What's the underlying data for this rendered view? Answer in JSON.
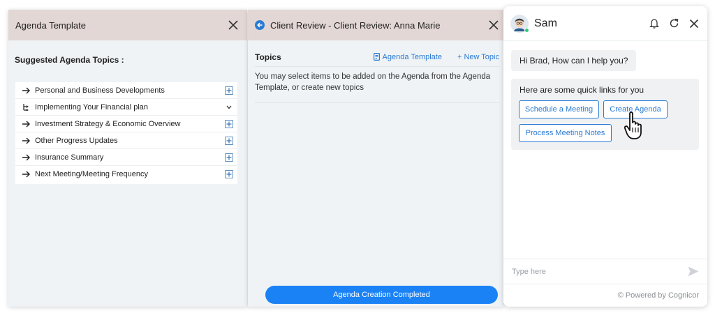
{
  "agenda_panel": {
    "title": "Agenda Template",
    "suggested_label": "Suggested Agenda Topics :",
    "topics": [
      {
        "label": "Personal and Business Developments",
        "icon": "arrow-right-icon",
        "action": "plus-box-icon"
      },
      {
        "label": "Implementing Your Financial plan",
        "icon": "subtopics-icon",
        "action": "chevron-down-icon"
      },
      {
        "label": "Investment Strategy & Economic Overview",
        "icon": "arrow-right-icon",
        "action": "plus-box-icon"
      },
      {
        "label": "Other Progress Updates",
        "icon": "arrow-right-icon",
        "action": "plus-box-icon"
      },
      {
        "label": "Insurance Summary",
        "icon": "arrow-right-icon",
        "action": "plus-box-icon"
      },
      {
        "label": "Next Meeting/Meeting Frequency",
        "icon": "arrow-right-icon",
        "action": "plus-box-icon"
      }
    ]
  },
  "review_panel": {
    "title": "Client Review - Client Review: Anna Marie",
    "topics_label": "Topics",
    "agenda_template_link": "Agenda Template",
    "new_topic_link": "+ New Topic",
    "description": "You may select items to be added on the Agenda from the Agenda Template, or create new topics",
    "complete_button": "Agenda Creation Completed"
  },
  "chat_panel": {
    "bot_name": "Sam",
    "greeting": "Hi Brad, How can I help you?",
    "quick_links_title": "Here are some quick links for you",
    "quick_links": [
      "Schedule a Meeting",
      "Create Agenda",
      "Process Meeting Notes"
    ],
    "input_placeholder": "Type here",
    "powered_by": "© Powered by Cognicor"
  },
  "colors": {
    "header_bg": "#e3d7d5",
    "panel_bg": "#eff3f6",
    "accent_blue": "#1a82f5",
    "link_blue": "#2a7bd3",
    "online_green": "#2ecc71"
  }
}
